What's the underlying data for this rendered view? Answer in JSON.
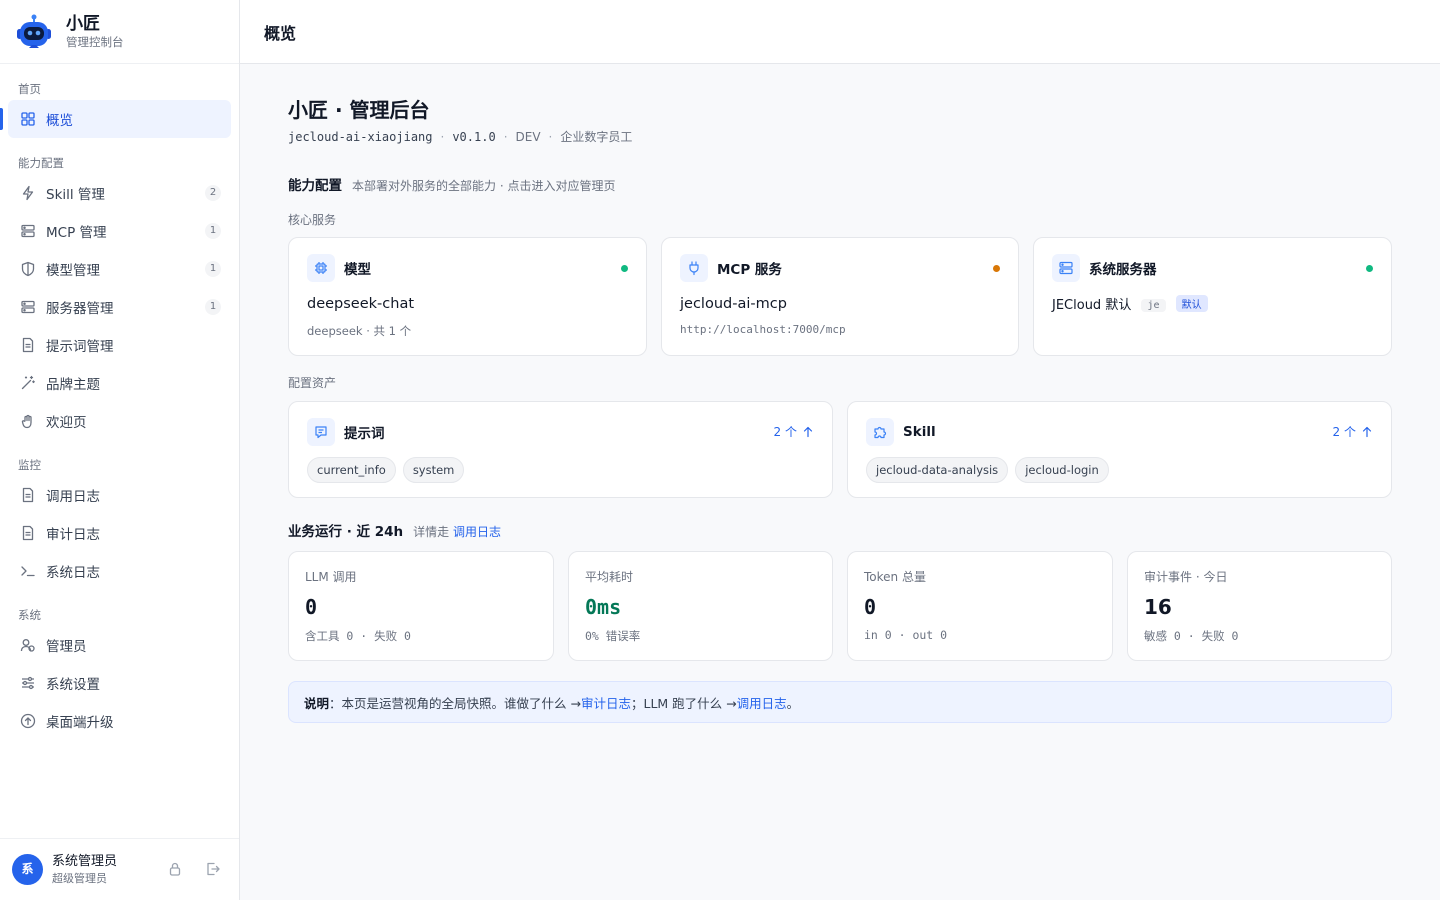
{
  "brand": {
    "title": "小匠",
    "subtitle": "管理控制台"
  },
  "sidebar": {
    "groups": [
      {
        "label": "首页",
        "items": [
          {
            "label": "概览",
            "icon": "grid-icon",
            "active": true
          }
        ]
      },
      {
        "label": "能力配置",
        "items": [
          {
            "label": "Skill 管理",
            "icon": "bolt-icon",
            "count": "2"
          },
          {
            "label": "MCP 管理",
            "icon": "server-icon",
            "count": "1"
          },
          {
            "label": "模型管理",
            "icon": "shield-icon",
            "count": "1"
          },
          {
            "label": "服务器管理",
            "icon": "server-icon",
            "count": "1"
          },
          {
            "label": "提示词管理",
            "icon": "document-icon"
          },
          {
            "label": "品牌主题",
            "icon": "magic-wand-icon"
          },
          {
            "label": "欢迎页",
            "icon": "hand-wave-icon"
          }
        ]
      },
      {
        "label": "监控",
        "items": [
          {
            "label": "调用日志",
            "icon": "document-icon"
          },
          {
            "label": "审计日志",
            "icon": "document-icon"
          },
          {
            "label": "系统日志",
            "icon": "terminal-icon"
          }
        ]
      },
      {
        "label": "系统",
        "items": [
          {
            "label": "管理员",
            "icon": "users-icon"
          },
          {
            "label": "系统设置",
            "icon": "sliders-icon"
          },
          {
            "label": "桌面端升级",
            "icon": "upgrade-icon"
          }
        ]
      }
    ]
  },
  "user": {
    "avatar": "系",
    "name": "系统管理员",
    "role": "超级管理员"
  },
  "topbar": {
    "title": "概览"
  },
  "page": {
    "title": "小匠 · 管理后台",
    "meta": {
      "app_id": "jecloud-ai-xiaojiang",
      "version": "v0.1.0",
      "env": "DEV",
      "desc": "企业数字员工"
    }
  },
  "capabilities": {
    "title": "能力配置",
    "desc": "本部署对外服务的全部能力 · 点击进入对应管理页",
    "core_label": "核心服务",
    "core": [
      {
        "title": "模型",
        "icon": "chip-icon",
        "main": "deepseek-chat",
        "sub": "deepseek · 共 1 个",
        "status_color": "#10b981"
      },
      {
        "title": "MCP 服务",
        "icon": "plug-icon",
        "main": "jecloud-ai-mcp",
        "sub": "http://localhost:7000/mcp",
        "status_color": "#d97706"
      },
      {
        "title": "系统服务器",
        "icon": "server-icon",
        "main": "JECloud 默认",
        "chip1": "je",
        "chip2": "默认",
        "status_color": "#10b981"
      }
    ],
    "assets_label": "配置资产",
    "assets": [
      {
        "title": "提示词",
        "icon": "prompt-icon",
        "count": "2 个",
        "tags": [
          "current_info",
          "system"
        ]
      },
      {
        "title": "Skill",
        "icon": "puzzle-icon",
        "count": "2 个",
        "tags": [
          "jecloud-data-analysis",
          "jecloud-login"
        ]
      }
    ]
  },
  "business": {
    "title": "业务运行 · 近 24h",
    "detail_prefix": "详情走",
    "detail_link": "调用日志",
    "stats": [
      {
        "label": "LLM 调用",
        "value": "0",
        "foot": "含工具 0 · 失败 0",
        "color": "#111827"
      },
      {
        "label": "平均耗时",
        "value": "0ms",
        "foot": "0% 错误率",
        "color": "#047857"
      },
      {
        "label": "Token 总量",
        "value": "0",
        "foot": "in 0 · out 0",
        "color": "#111827"
      },
      {
        "label": "审计事件 · 今日",
        "value": "16",
        "foot": "敏感 0 · 失败 0",
        "color": "#111827"
      }
    ]
  },
  "note": {
    "label": "说明",
    "text1": "：本页是运营视角的全局快照。谁做了什么 → ",
    "link1": "审计日志",
    "text2": "；LLM 跑了什么 → ",
    "link2": "调用日志",
    "text3": "。"
  }
}
